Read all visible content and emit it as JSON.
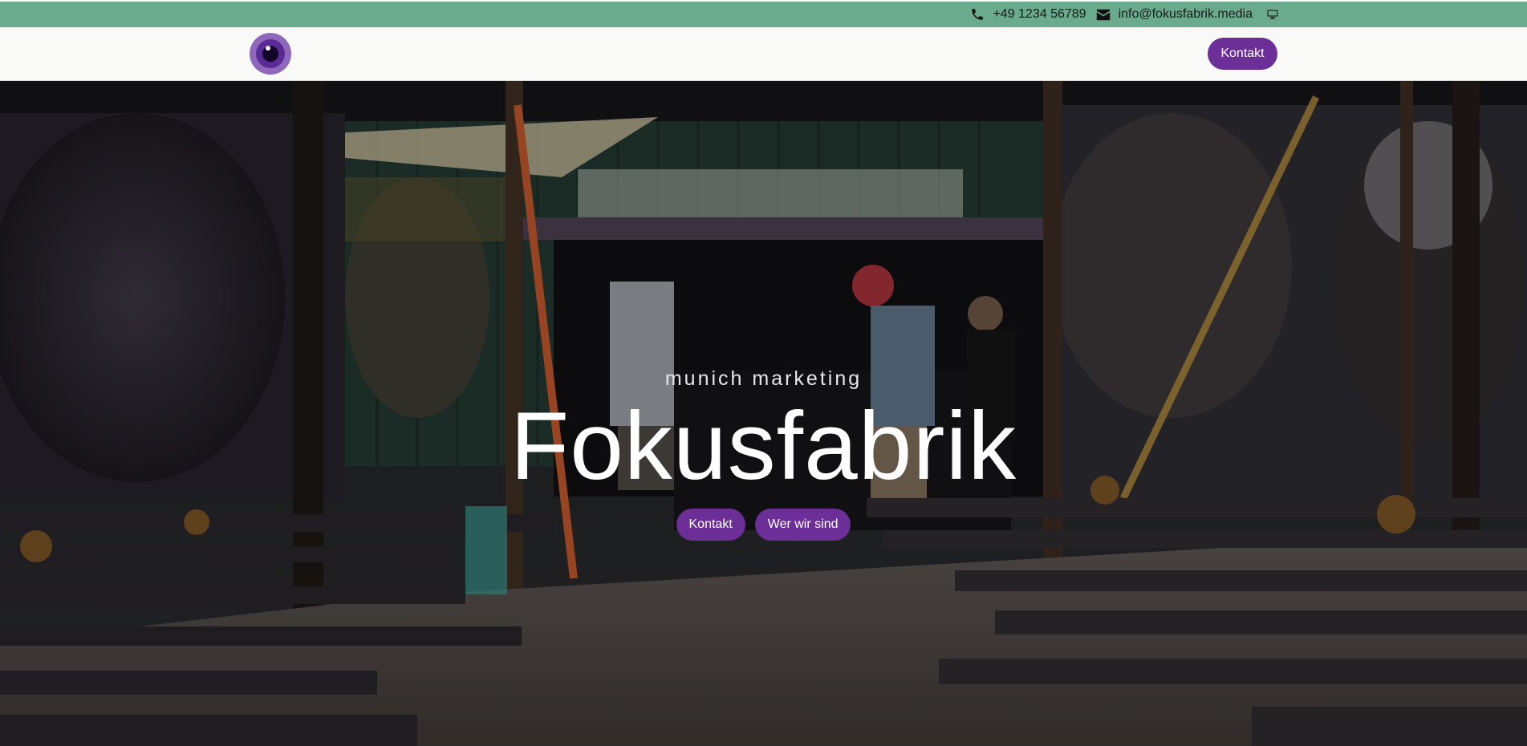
{
  "topbar": {
    "phone": "+49 1234 56789",
    "email": "info@fokusfabrik.media",
    "icons": [
      "phone-icon",
      "envelope-icon",
      "monitor-icon"
    ],
    "color": "#6aab8e"
  },
  "navbar": {
    "contact_label": "Kontakt",
    "logo_icon": "eye-lens-logo-icon"
  },
  "hero": {
    "subtitle": "munich marketing",
    "title": "Fokusfabrik",
    "buttons": {
      "contact_label": "Kontakt",
      "about_label": "Wer wir sind"
    }
  },
  "colors": {
    "accent": "#6b2f97",
    "topbar": "#6aab8e",
    "navbar_bg": "#f9f9f7"
  }
}
